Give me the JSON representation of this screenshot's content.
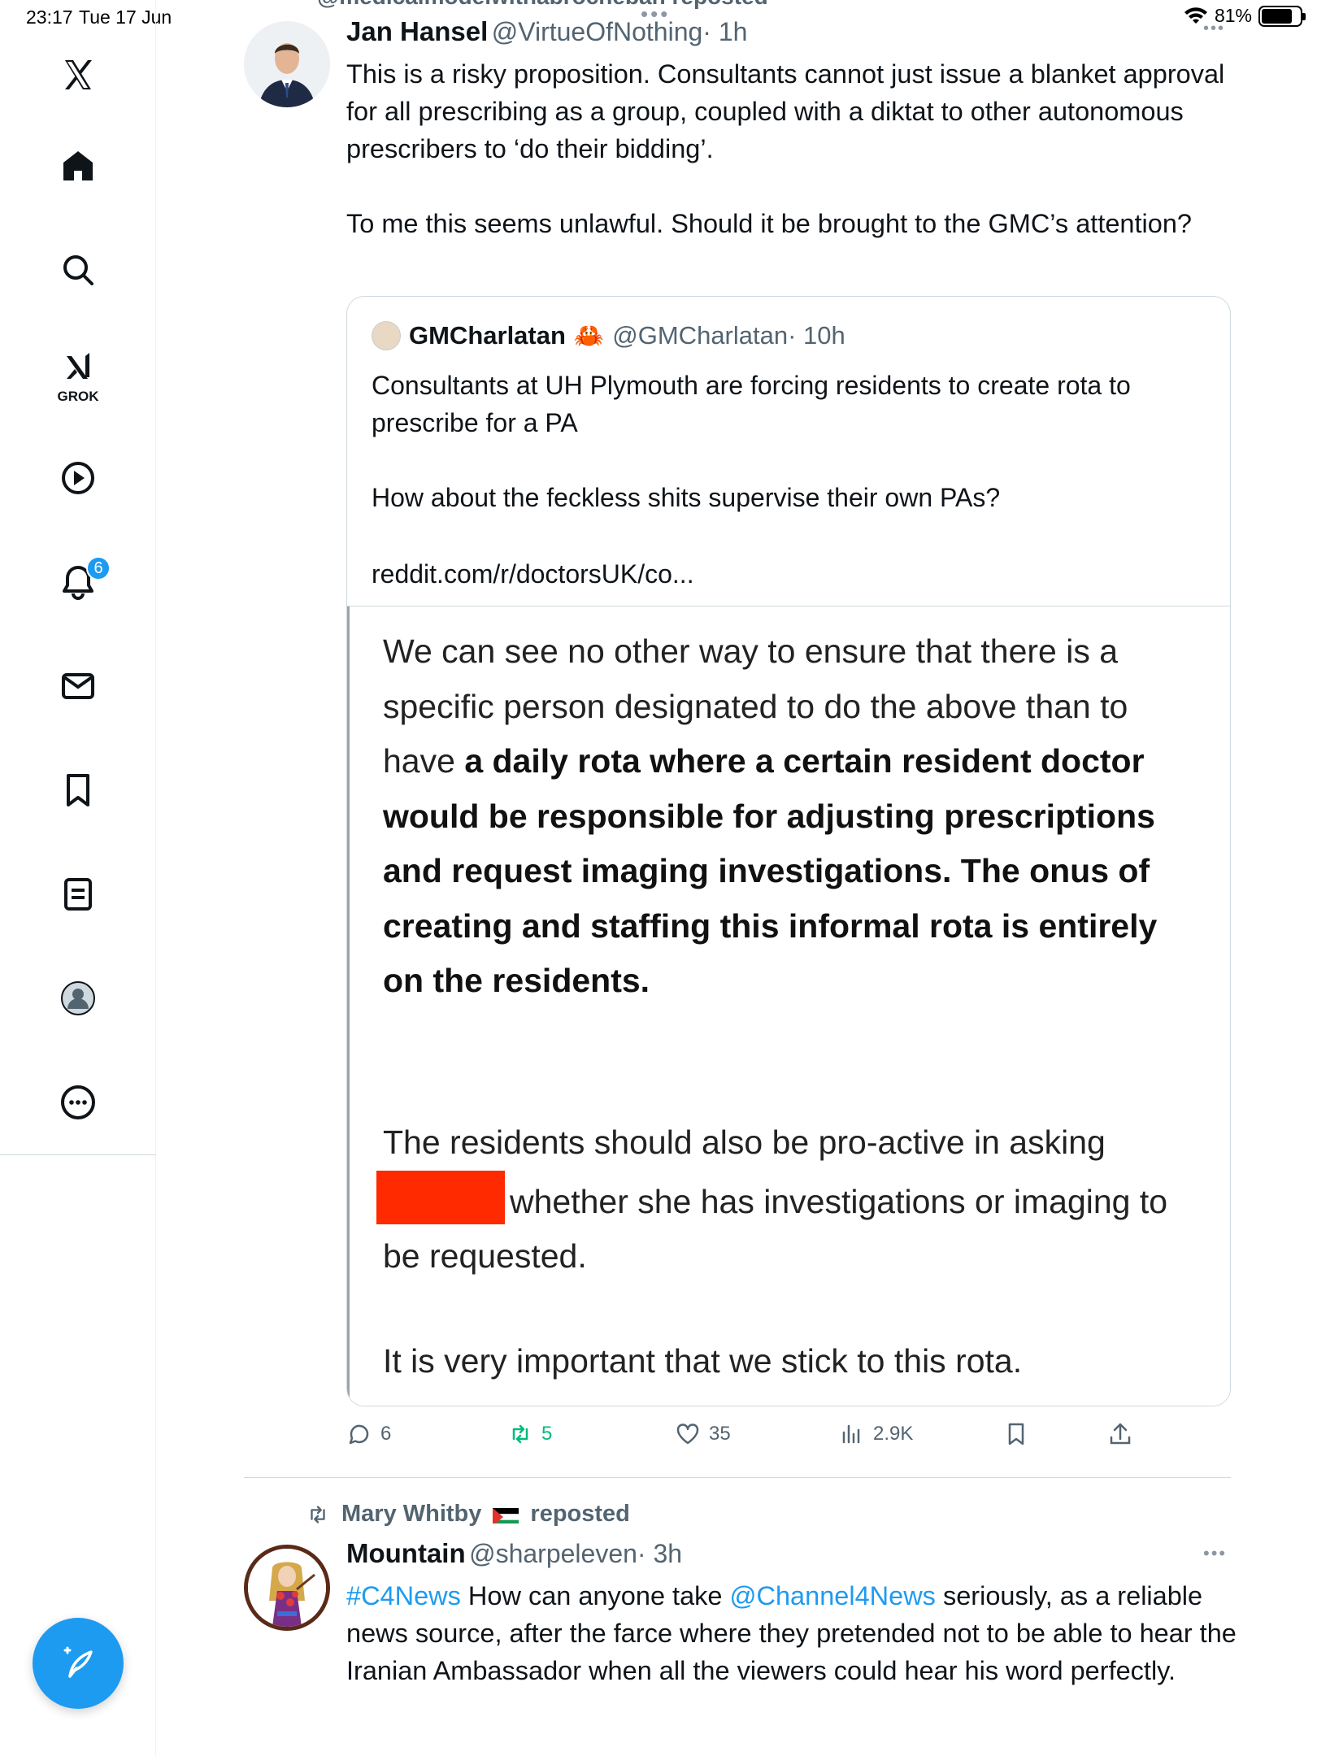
{
  "status_bar": {
    "time": "23:17",
    "date": "Tue 17 Jun",
    "battery": "81%",
    "battery_level": 0.81
  },
  "top_cutoff_text": "@medicalmodelwithabrocheban reposted",
  "sidebar": {
    "items": [
      {
        "icon": "x-logo-icon"
      },
      {
        "icon": "home-icon"
      },
      {
        "icon": "search-icon"
      },
      {
        "icon": "grok-icon",
        "label": "GROK"
      },
      {
        "icon": "video-icon"
      },
      {
        "icon": "notifications-icon",
        "badge": "6"
      },
      {
        "icon": "messages-icon"
      },
      {
        "icon": "bookmarks-icon"
      },
      {
        "icon": "lists-icon"
      },
      {
        "icon": "profile-icon"
      },
      {
        "icon": "more-icon"
      }
    ],
    "compose_icon": "compose-icon"
  },
  "tweet1": {
    "name": "Jan Hansel",
    "handle": "@VirtueOfNothing",
    "time": "· 1h",
    "text_p1": "This is a risky proposition. Consultants cannot just issue a blanket approval for all prescribing as a group, coupled with a diktat to other autonomous prescribers to ‘do their bidding’.",
    "text_p2": "To me this seems unlawful. Should it be brought to the GMC’s attention?",
    "quote": {
      "name": "GMCharlatan",
      "emoji": "🦀",
      "handle": "@GMCharlatan",
      "time": "· 10h",
      "text_p1": "Consultants at UH Plymouth are forcing residents to create rota to prescribe for a PA",
      "text_p2": "How about the feckless shits supervise their own PAs?",
      "link": "reddit.com/r/doctorsUK/co...",
      "image": {
        "p1_lead": "We can see no other way to ensure that there is a specific person designated to do the above than to have ",
        "p1_bold": "a daily rota where a certain resident doctor would be responsible for adjusting prescriptions and request imaging investigations. The onus of creating and staffing this informal rota is entirely on the residents.",
        "p2_lead": "The residents should also be pro-active in asking ",
        "p2_tail": "whether she has investigations or imaging to be requested.",
        "p3": "It is very important that we stick to this rota."
      }
    },
    "actions": {
      "replies": "6",
      "reposts": "5",
      "likes": "35",
      "views": "2.9K"
    }
  },
  "tweet2": {
    "reposted_by": "Mary Whitby",
    "reposted_label": "reposted",
    "name": "Mountain",
    "handle": "@sharpeleven",
    "time": "· 3h",
    "hashtag": "#C4News",
    "text_a": " How can anyone take ",
    "mention": "@Channel4News",
    "text_b": " seriously, as a reliable news source, after the farce where they pretended not to be able to hear the Iranian Ambassador when all the viewers could hear his word perfectly."
  },
  "colors": {
    "accent": "#1d9bf0",
    "repost_green": "#00ba7c",
    "redaction": "#ff2a00",
    "secondary_text": "#536471"
  }
}
